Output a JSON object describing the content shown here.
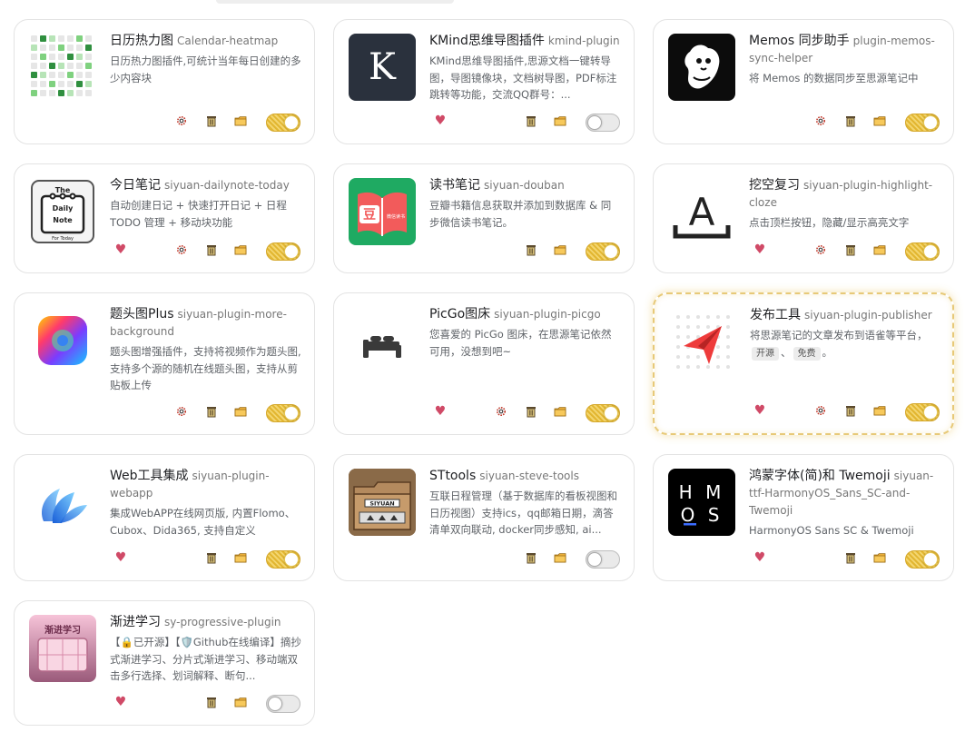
{
  "plugins": [
    {
      "title": "日历热力图",
      "pkg": "Calendar-heatmap",
      "desc": "日历热力图插件,可统计当年每日创建的多少内容块",
      "enabled": true
    },
    {
      "title": "KMind思维导图插件",
      "pkg": "kmind-plugin",
      "desc": "KMind思维导图插件,思源文档一键转导图，导图镜像块，文档树导图，PDF标注跳转等功能，交流QQ群号：...",
      "enabled": false
    },
    {
      "title": "Memos 同步助手",
      "pkg": "plugin-memos-sync-helper",
      "desc": "将 Memos 的数据同步至思源笔记中",
      "enabled": true
    },
    {
      "title": "今日笔记",
      "pkg": "siyuan-dailynote-today",
      "desc": "自动创建日记 + 快速打开日记 + 日程 TODO 管理 + 移动块功能",
      "enabled": true
    },
    {
      "title": "读书笔记",
      "pkg": "siyuan-douban",
      "desc": "豆瓣书籍信息获取并添加到数据库 & 同步微信读书笔记。",
      "enabled": true
    },
    {
      "title": "挖空复习",
      "pkg": "siyuan-plugin-highlight-cloze",
      "desc": "点击顶栏按钮，隐藏/显示高亮文字",
      "enabled": true
    },
    {
      "title": "题头图Plus",
      "pkg": "siyuan-plugin-more-background",
      "desc": "题头图增强插件，支持将视频作为题头图, 支持多个源的随机在线题头图，支持从剪贴板上传",
      "enabled": true
    },
    {
      "title": "PicGo图床",
      "pkg": "siyuan-plugin-picgo",
      "desc": "您喜爱的 PicGo 图床，在思源笔记依然可用，没想到吧~",
      "enabled": true
    },
    {
      "title": "发布工具",
      "pkg": "siyuan-plugin-publisher",
      "desc": "将思源笔记的文章发布到语雀等平台，",
      "tags": [
        "开源",
        "免费"
      ],
      "tag_sep": "、",
      "tag_end": "。",
      "enabled": true
    },
    {
      "title": "Web工具集成",
      "pkg": "siyuan-plugin-webapp",
      "desc": "集成WebAPP在线网页版, 内置Flomo、Cubox、Dida365, 支持自定义",
      "enabled": true
    },
    {
      "title": "STtools",
      "pkg": "siyuan-steve-tools",
      "desc": "互联日程管理（基于数据库的看板视图和日历视图）支持ics，qq邮箱日期，滴答清单双向联动, docker同步感知, ai...",
      "enabled": false
    },
    {
      "title": "鸿蒙字体(简)和 Twemoji",
      "pkg": "siyuan-ttf-HarmonyOS_Sans_SC-and-Twemoji",
      "desc": "HarmonyOS Sans SC & Twemoji",
      "enabled": true
    },
    {
      "title": "渐进学习",
      "pkg": "sy-progressive-plugin",
      "desc": "【🔒已开源】【🛡️Github在线编译】摘抄式渐进学习、分片式渐进学习、移动端双击多行选择、划词解释、断句...",
      "enabled": false
    }
  ],
  "logos": {
    "daily_top": "The",
    "daily_main1": "Daily",
    "daily_main2": "Note",
    "daily_bottom": "For Today",
    "douban_char": "豆",
    "douban_badge": "微信读书",
    "kmind_letter": "K",
    "cloze_letter": "A",
    "harmony_top": "H M",
    "harmony_bottom": "O S",
    "sttools_label": "SIYUAN",
    "progress_label": "渐进学习"
  },
  "colors": {
    "heart": "#d04a67",
    "toggle_on": "#e2b631",
    "toggle_off": "#eaeaea",
    "featured_border": "#e7c978"
  }
}
